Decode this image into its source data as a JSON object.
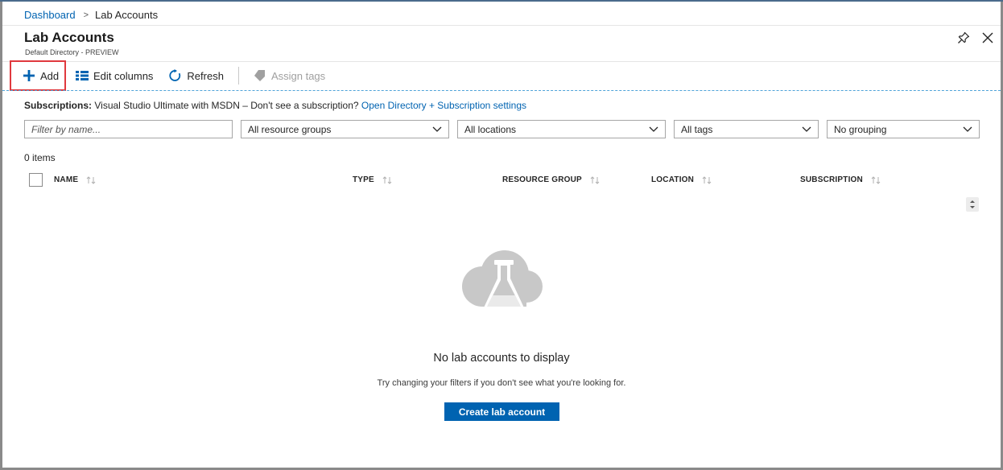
{
  "breadcrumb": {
    "items": [
      "Dashboard",
      "Lab Accounts"
    ],
    "separator": ">"
  },
  "header": {
    "title": "Lab Accounts",
    "subtitle": "Default Directory - PREVIEW",
    "icons": [
      "pin-icon",
      "close-icon"
    ]
  },
  "toolbar": {
    "add_label": "Add",
    "edit_columns_label": "Edit columns",
    "refresh_label": "Refresh",
    "assign_tags_label": "Assign tags"
  },
  "subscriptions": {
    "label": "Subscriptions:",
    "text": "Visual Studio Ultimate with MSDN – Don't see a subscription?",
    "link": "Open Directory + Subscription settings"
  },
  "filters": {
    "name_placeholder": "Filter by name...",
    "resource_groups": "All resource groups",
    "locations": "All locations",
    "tags": "All tags",
    "grouping": "No grouping"
  },
  "list": {
    "count_text": "0 items",
    "columns": [
      "NAME",
      "TYPE",
      "RESOURCE GROUP",
      "LOCATION",
      "SUBSCRIPTION"
    ]
  },
  "empty_state": {
    "title": "No lab accounts to display",
    "hint": "Try changing your filters if you don't see what you're looking for.",
    "button_label": "Create lab account"
  },
  "colors": {
    "accent": "#0063b1",
    "highlight_border": "#e0393e",
    "illustration": "#c8c8c8"
  }
}
